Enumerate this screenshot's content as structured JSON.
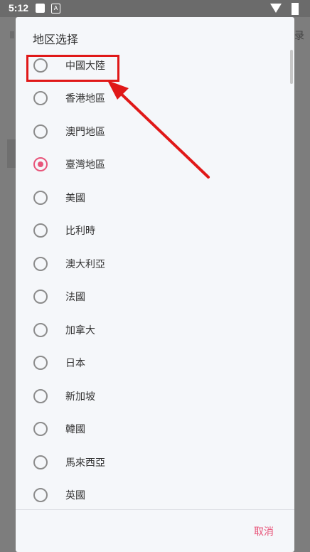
{
  "status_bar": {
    "time": "5:12",
    "notif_icon_2": "A"
  },
  "background": {
    "edge_text": "录"
  },
  "dialog": {
    "title": "地区选择",
    "options": [
      {
        "label": "中國大陸",
        "selected": false
      },
      {
        "label": "香港地區",
        "selected": false
      },
      {
        "label": "澳門地區",
        "selected": false
      },
      {
        "label": "臺灣地區",
        "selected": true
      },
      {
        "label": "美國",
        "selected": false
      },
      {
        "label": "比利時",
        "selected": false
      },
      {
        "label": "澳大利亞",
        "selected": false
      },
      {
        "label": "法國",
        "selected": false
      },
      {
        "label": "加拿大",
        "selected": false
      },
      {
        "label": "日本",
        "selected": false
      },
      {
        "label": "新加坡",
        "selected": false
      },
      {
        "label": "韓國",
        "selected": false
      },
      {
        "label": "馬來西亞",
        "selected": false
      },
      {
        "label": "英國",
        "selected": false
      }
    ],
    "cancel_label": "取消"
  },
  "colors": {
    "accent": "#e8557a",
    "annotation": "#e01818"
  }
}
